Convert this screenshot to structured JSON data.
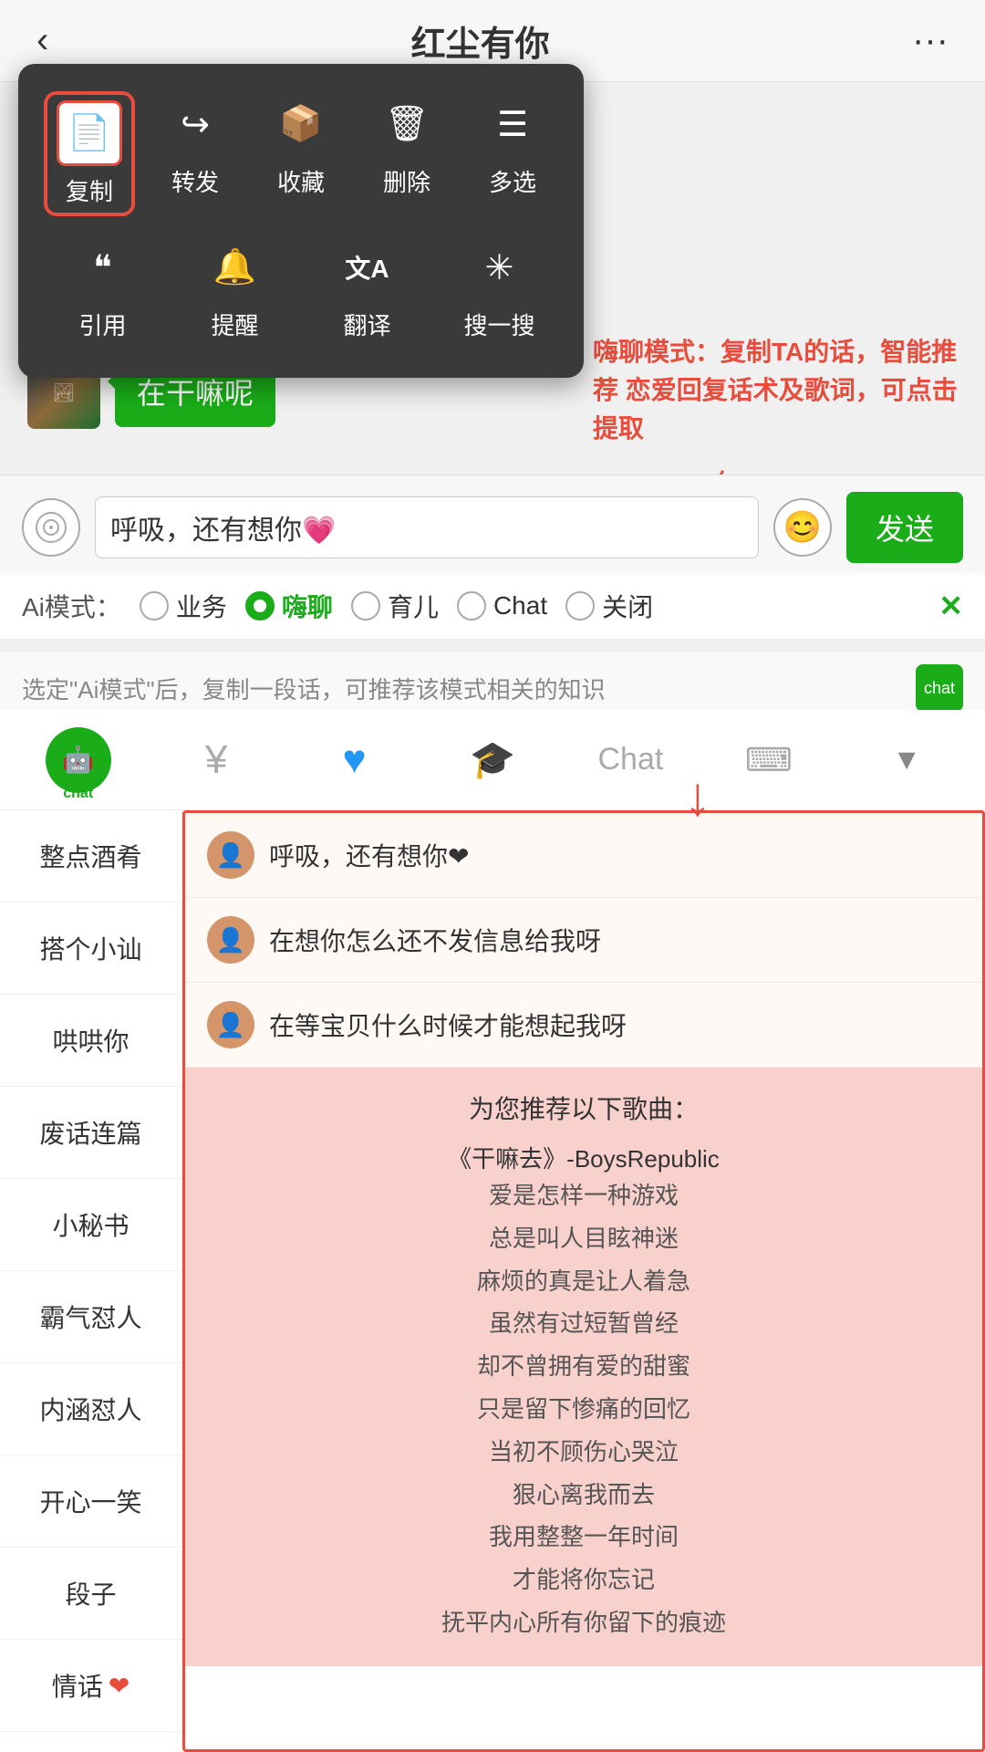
{
  "header": {
    "title": "红尘有你",
    "back_icon": "‹",
    "more_icon": "···"
  },
  "context_menu": {
    "items_row1": [
      {
        "id": "copy",
        "icon": "📄",
        "label": "复制",
        "highlighted": true
      },
      {
        "id": "forward",
        "icon": "↪",
        "label": "转发",
        "highlighted": false
      },
      {
        "id": "collect",
        "icon": "📦",
        "label": "收藏",
        "highlighted": false
      },
      {
        "id": "delete",
        "icon": "🗑",
        "label": "删除",
        "highlighted": false
      },
      {
        "id": "multiselect",
        "icon": "☰",
        "label": "多选",
        "highlighted": false
      }
    ],
    "items_row2": [
      {
        "id": "quote",
        "icon": "❝",
        "label": "引用",
        "highlighted": false
      },
      {
        "id": "remind",
        "icon": "🔔",
        "label": "提醒",
        "highlighted": false
      },
      {
        "id": "translate",
        "icon": "文A",
        "label": "翻译",
        "highlighted": false
      },
      {
        "id": "search",
        "icon": "✳",
        "label": "搜一搜",
        "highlighted": false
      }
    ]
  },
  "annotation": {
    "text": "嗨聊模式：复制TA的话，智能推荐\n恋爱回复话术及歌词，可点击提取"
  },
  "chat_message": {
    "bubble_text": "在干嘛呢"
  },
  "input_bar": {
    "voice_icon": "◉",
    "placeholder": "呼吸，还有想你💗",
    "input_value": "呼吸，还有想你💗",
    "emoji_icon": "😊",
    "send_label": "发送"
  },
  "ai_mode": {
    "label": "Ai模式：",
    "options": [
      {
        "id": "business",
        "label": "业务",
        "active": false
      },
      {
        "id": "haichat",
        "label": "嗨聊",
        "active": true
      },
      {
        "id": "parenting",
        "label": "育儿",
        "active": false
      },
      {
        "id": "chat",
        "label": "Chat",
        "active": false
      },
      {
        "id": "off",
        "label": "关闭",
        "active": false
      }
    ],
    "close_label": "✕"
  },
  "ai_hint": {
    "text": "选定\"Ai模式\"后，复制一段话，可推荐该模式相关的知识",
    "chat_icon": "chat"
  },
  "toolbar": {
    "items": [
      {
        "id": "robot",
        "type": "robot",
        "label": "chat"
      },
      {
        "id": "money",
        "icon": "¥",
        "label": ""
      },
      {
        "id": "heart",
        "icon": "♥",
        "label": ""
      },
      {
        "id": "grad",
        "icon": "🎓",
        "label": ""
      },
      {
        "id": "chat_text",
        "icon": "Chat",
        "label": ""
      },
      {
        "id": "keyboard",
        "icon": "⌨",
        "label": ""
      },
      {
        "id": "arrow_down",
        "icon": "▼",
        "label": ""
      }
    ]
  },
  "sidebar": {
    "items": [
      {
        "id": "zhengdian",
        "label": "整点酒肴",
        "suffix": ""
      },
      {
        "id": "dadao",
        "label": "搭个小讪",
        "suffix": ""
      },
      {
        "id": "houhou",
        "label": "哄哄你",
        "suffix": ""
      },
      {
        "id": "feihua",
        "label": "废话连篇",
        "suffix": ""
      },
      {
        "id": "mishu",
        "label": "小秘书",
        "suffix": ""
      },
      {
        "id": "baqiren",
        "label": "霸气怼人",
        "suffix": ""
      },
      {
        "id": "neihanrennei",
        "label": "内涵怼人",
        "suffix": ""
      },
      {
        "id": "kaixin",
        "label": "开心一笑",
        "suffix": ""
      },
      {
        "id": "duanzi",
        "label": "段子",
        "suffix": ""
      },
      {
        "id": "qinghua",
        "label": "情话",
        "suffix": "❤"
      }
    ]
  },
  "suggestions": [
    {
      "id": 1,
      "text": "呼吸，还有想你❤"
    },
    {
      "id": 2,
      "text": "在想你怎么还不发信息给我呀"
    },
    {
      "id": 3,
      "text": "在等宝贝什么时候才能想起我呀"
    }
  ],
  "song_section": {
    "title": "为您推荐以下歌曲：",
    "song_name": "《干嘛去》-BoysRepublic",
    "lyrics": [
      "爱是怎样一种游戏",
      "总是叫人目眩神迷",
      "麻烦的真是让人着急",
      "虽然有过短暂曾经",
      "却不曾拥有爱的甜蜜",
      "只是留下惨痛的回忆",
      "当初不顾伤心哭泣",
      "狠心离我而去",
      "我用整整一年时间",
      "才能将你忘记",
      "抚平内心所有你留下的痕迹"
    ]
  }
}
